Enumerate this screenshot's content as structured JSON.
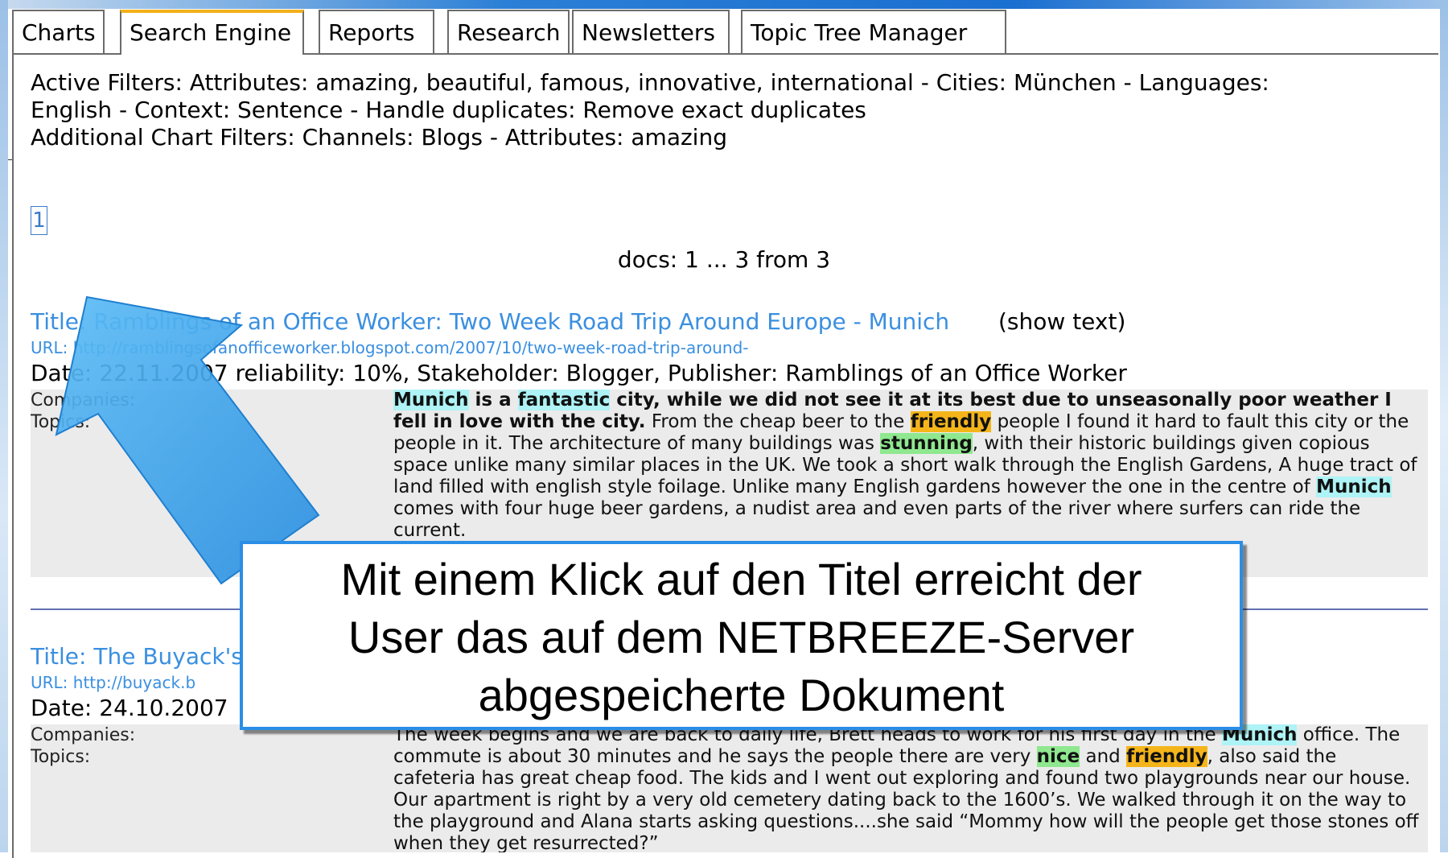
{
  "tabs": [
    {
      "label": "Charts",
      "active": false
    },
    {
      "label": "Search Engine",
      "active": true
    },
    {
      "label": "Reports",
      "active": false
    },
    {
      "label": "Research",
      "active": false
    },
    {
      "label": "Newsletters",
      "active": false
    },
    {
      "label": "Topic Tree Manager",
      "active": false
    }
  ],
  "filters": {
    "line1": "Active Filters: Attributes: amazing, beautiful, famous, innovative, international - Cities: München - Languages:",
    "line2": "English - Context: Sentence - Handle duplicates: Remove exact duplicates",
    "line3": "Additional Chart Filters: Channels: Blogs - Attributes: amazing"
  },
  "pagination": {
    "page": "1"
  },
  "docs_count": "docs: 1 ... 3 from 3",
  "documents": [
    {
      "title": "Title: Ramblings of an Office Worker: Two Week Road Trip Around Europe - Munich",
      "show_text": "(show text)",
      "url": "URL: http://ramblingsofanofficeworker.blogspot.com/2007/10/two-week-road-trip-around-",
      "meta": "Date: 22.11.2007 reliability: 10%, Stakeholder: Blogger, Publisher: Ramblings of an Office Worker",
      "companies_label": "Companies:",
      "topics_label": "Topics:",
      "snippet": [
        {
          "t": "Munich",
          "s": "bc"
        },
        {
          "t": " is a ",
          "s": "b"
        },
        {
          "t": "fantastic",
          "s": "bc"
        },
        {
          "t": " city, while we did not see it at its best due to unseasonally poor weather I fell in love with the city.",
          "s": "b"
        },
        {
          "t": " From the cheap beer to the ",
          "s": ""
        },
        {
          "t": "friendly",
          "s": "bo"
        },
        {
          "t": " people I found it hard to fault this city or the people in it. The architecture of many buildings was ",
          "s": ""
        },
        {
          "t": "stunning",
          "s": "bg"
        },
        {
          "t": ", with their historic buildings given copious space unlike many similar places in the UK. We took a short walk through the English Gardens, A huge tract of land filled with english style foilage. Unlike many English gardens however the one in the centre of ",
          "s": ""
        },
        {
          "t": "Munich",
          "s": "bc"
        },
        {
          "t": " comes with four huge beer gardens, a nudist area and even parts of the river where surfers can ride the current.",
          "s": ""
        }
      ]
    },
    {
      "title": "Title: The Buyack's",
      "url": "URL: http://buyack.b",
      "meta": "Date: 24.10.2007",
      "companies_label": "Companies:",
      "topics_label": "Topics:",
      "snippet": [
        {
          "t": "The week begins and we are back to daily life, Brett heads to work for his first day in the ",
          "s": ""
        },
        {
          "t": "Munich",
          "s": "bc"
        },
        {
          "t": " office. The commute is about 30 minutes and he says the people there are very ",
          "s": ""
        },
        {
          "t": "nice",
          "s": "bg"
        },
        {
          "t": " and ",
          "s": ""
        },
        {
          "t": "friendly",
          "s": "bo"
        },
        {
          "t": ", also said the cafeteria has great cheap food. The kids and I went out exploring and found two playgrounds near our house. Our apartment is right by a very old cemetery dating back to the 1600’s. We walked through it on the way to the playground and Alana starts asking questions....she said “Mommy how will the people get those stones off when they get resurrected?”",
          "s": ""
        }
      ]
    }
  ],
  "callout": {
    "line1": "Mit einem Klick auf den Titel erreicht der",
    "line2": "User das auf dem NETBREEZE-Server",
    "line3": "abgespeicherte Dokument"
  },
  "colors": {
    "link": "#3a8fe0",
    "active_tab_accent": "#f3b019",
    "callout_border": "#2b8ee6",
    "arrow": "#3aa3ec"
  }
}
